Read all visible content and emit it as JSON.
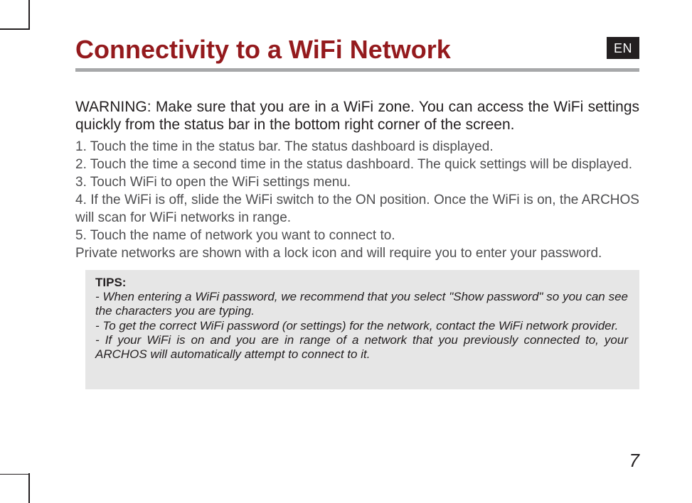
{
  "lang_tab": "EN",
  "title": "Connectivity to a WiFi Network",
  "warning": "WARNING:  Make sure that you are in a WiFi zone. You can access the WiFi settings quickly from the status bar in the bottom right corner of the screen.",
  "steps": [
    "1. Touch the time in the status bar. The status dashboard is displayed.",
    "2. Touch the time a second time in the status dashboard. The quick settings will be displayed.",
    "3. Touch WiFi to open the WiFi settings menu.",
    "4. If the WiFi is off, slide the WiFi switch to the ON position. Once the WiFi is on, the ARCHOS will scan for WiFi networks in range.",
    "5. Touch the name of network you want to connect to.",
    "Private networks are shown with a lock icon and will require you to enter your password."
  ],
  "tips_heading": "TIPS:",
  "tips": [
    "- When entering a WiFi password, we recommend that you select \"Show password\" so you can see the characters you are typing.",
    "- To get the correct WiFi password (or settings) for the network, contact the WiFi network provider.",
    "- If your WiFi is on and you are in range of a network that you previously connected to, your ARCHOS will automatically attempt to connect to it."
  ],
  "page_number": "7"
}
